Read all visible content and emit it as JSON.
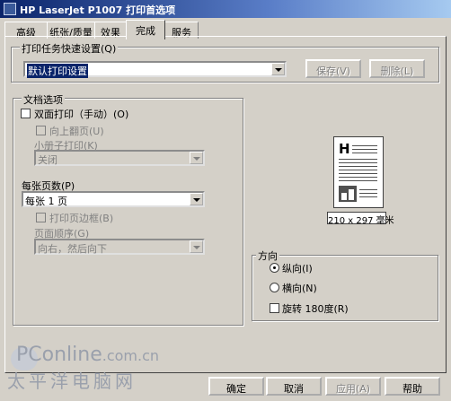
{
  "window": {
    "title": "HP LaserJet P1007 打印首选项"
  },
  "tabs": [
    {
      "label": "高级"
    },
    {
      "label": "纸张/质量"
    },
    {
      "label": "效果"
    },
    {
      "label": "完成"
    },
    {
      "label": "服务"
    }
  ],
  "quick_sets": {
    "label": "打印任务快速设置(Q)",
    "value": "默认打印设置",
    "save_label": "保存(V)",
    "delete_label": "删除(L)"
  },
  "doc_options": {
    "label": "文档选项",
    "duplex_label": "双面打印（手动）(O)",
    "flip_label": "向上翻页(U)",
    "booklet_label": "小册子打印(K)",
    "booklet_value": "关闭",
    "pages_per_sheet_label": "每张页数(P)",
    "pages_per_sheet_value": "每张 1 页",
    "print_borders_label": "打印页边框(B)",
    "page_order_label": "页面顺序(G)",
    "page_order_value": "向右，然后向下"
  },
  "preview": {
    "paper_size": "210 x 297 毫米"
  },
  "orientation": {
    "label": "方向",
    "portrait_label": "纵向(I)",
    "landscape_label": "横向(N)",
    "rotate_label": "旋转 180度(R)",
    "selected": "portrait"
  },
  "footer": {
    "ok_label": "确定",
    "cancel_label": "取消",
    "apply_label": "应用(A)",
    "help_label": "帮助"
  },
  "watermark": {
    "brand": "PConline",
    "domain": ".com.cn",
    "cn_name": "太平洋电脑网"
  },
  "colors": {
    "title_bar": "#0a246a",
    "dialog_bg": "#d4d0c8",
    "selection": "#0a246a"
  }
}
